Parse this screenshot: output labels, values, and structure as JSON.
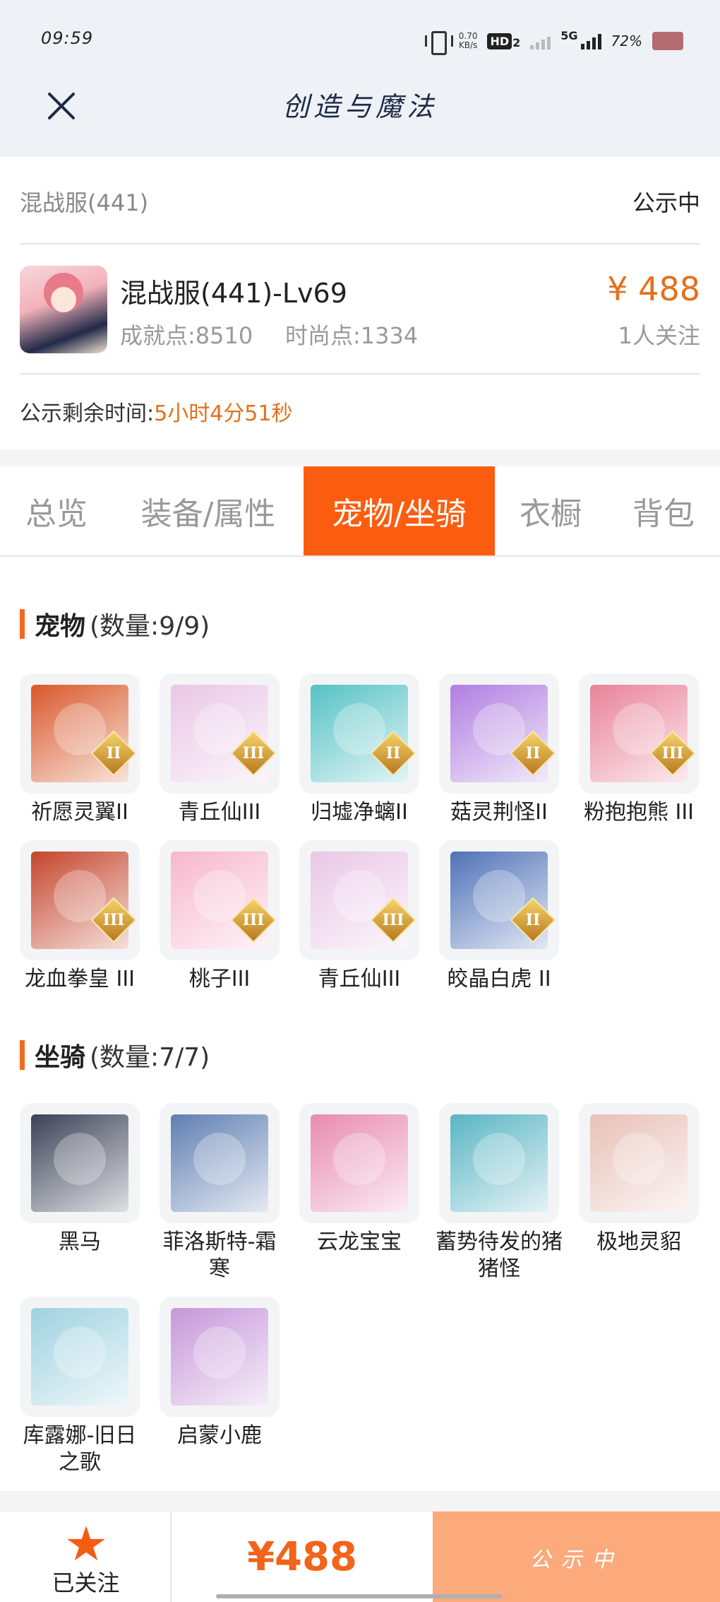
{
  "status_bar": {
    "time": "09:59",
    "net_speed_value": "0.70",
    "net_speed_unit": "KB/s",
    "hd_label": "HD",
    "hd_sub": "2",
    "network_label": "5G",
    "battery": "72%"
  },
  "header": {
    "title": "创造与魔法"
  },
  "listing": {
    "server": "混战服(441)",
    "status": "公示中",
    "character_title": "混战服(441)-Lv69",
    "achievement": "成就点:8510",
    "fashion": "时尚点:1334",
    "price": "¥ 488",
    "followers": "1人关注",
    "timer_label": "公示剩余时间:",
    "timer_value": "5小时4分51秒"
  },
  "tabs": [
    {
      "label": "总览",
      "active": false
    },
    {
      "label": "装备/属性",
      "active": false
    },
    {
      "label": "宠物/坐骑",
      "active": true
    },
    {
      "label": "衣橱",
      "active": false
    },
    {
      "label": "背包",
      "active": false
    }
  ],
  "pets": {
    "title": "宠物",
    "count": "(数量:9/9)",
    "items": [
      {
        "name": "祈愿灵翼II",
        "tier": "II",
        "icon": "griffin-pet-icon",
        "color": "#d9582a"
      },
      {
        "name": "青丘仙III",
        "tier": "III",
        "icon": "fox-fairy-pet-icon",
        "color": "#e9c7e6"
      },
      {
        "name": "归墟净螭II",
        "tier": "II",
        "icon": "water-dragon-pet-icon",
        "color": "#55c2c4"
      },
      {
        "name": "菇灵荆怪II",
        "tier": "II",
        "icon": "mushroom-sprite-pet-icon",
        "color": "#b07ee0"
      },
      {
        "name": "粉抱抱熊 III",
        "tier": "III",
        "icon": "pink-bear-pet-icon",
        "color": "#e9829a"
      },
      {
        "name": "龙血拳皇 III",
        "tier": "III",
        "icon": "dragon-boxer-pet-icon",
        "color": "#c5452c"
      },
      {
        "name": "桃子III",
        "tier": "III",
        "icon": "peach-bunny-pet-icon",
        "color": "#f7b7cd"
      },
      {
        "name": "青丘仙III",
        "tier": "III",
        "icon": "fox-fairy-pet-icon",
        "color": "#e9c7e6"
      },
      {
        "name": "皎晶白虎 II",
        "tier": "II",
        "icon": "white-tiger-pet-icon",
        "color": "#4f72b8"
      }
    ]
  },
  "mounts": {
    "title": "坐骑",
    "count": "(数量:7/7)",
    "items": [
      {
        "name": "黑马",
        "icon": "black-horse-mount-icon",
        "color": "#3b4257"
      },
      {
        "name": "菲洛斯特-霜寒",
        "icon": "frost-beast-mount-icon",
        "color": "#5f7fb2"
      },
      {
        "name": "云龙宝宝",
        "icon": "cloud-dragon-mount-icon",
        "color": "#e88bb0"
      },
      {
        "name": "蓄势待发的猪猪怪",
        "icon": "pig-monster-mount-icon",
        "color": "#5ab5c4"
      },
      {
        "name": "极地灵貂",
        "icon": "polar-mink-mount-icon",
        "color": "#e8c1b8"
      },
      {
        "name": "库露娜-旧日之歌",
        "icon": "kuluna-mount-icon",
        "color": "#9fd2e0"
      },
      {
        "name": "启蒙小鹿",
        "icon": "enlightenment-deer-mount-icon",
        "color": "#c697d9"
      }
    ]
  },
  "bottom_bar": {
    "follow_label": "已关注",
    "price": "¥488",
    "status_label": "公示中"
  },
  "colors": {
    "accent": "#fb5d10",
    "price": "#e4701c",
    "status_button": "#fca97c"
  }
}
